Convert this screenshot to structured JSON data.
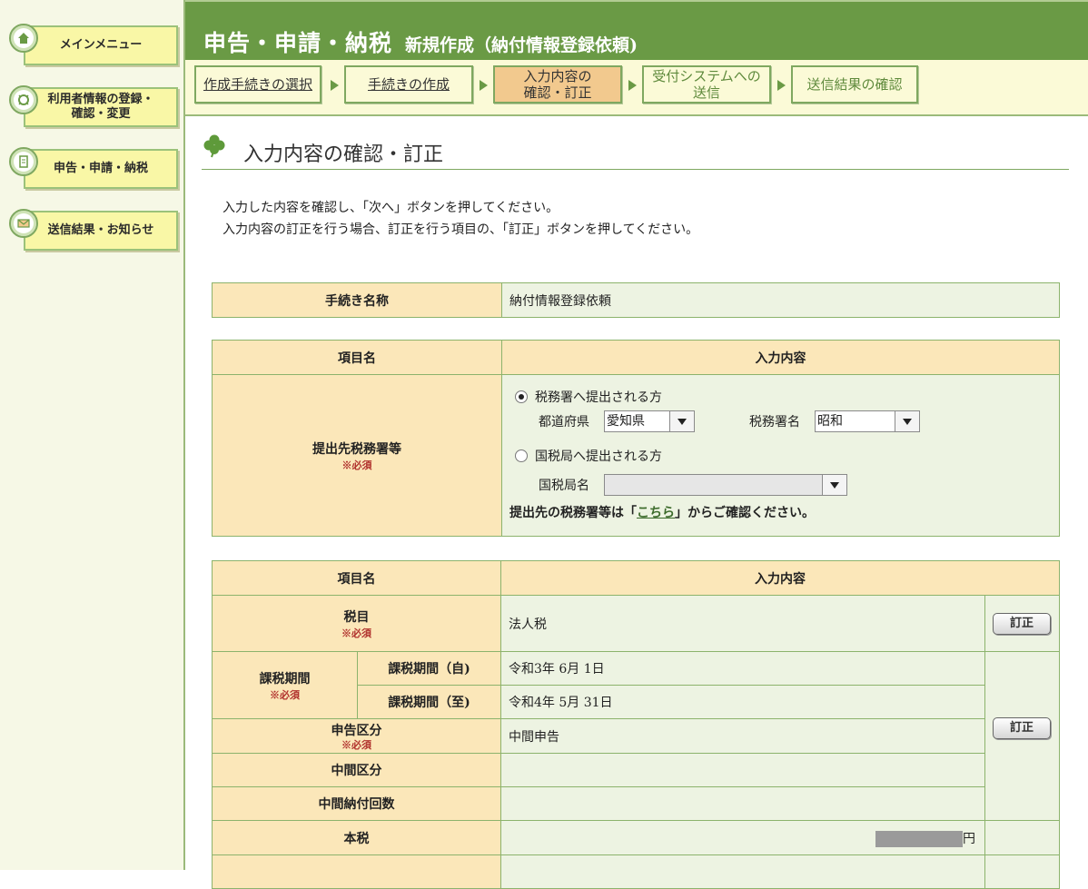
{
  "sidebar": {
    "items": [
      {
        "label": "メインメニュー",
        "icon": "home-icon"
      },
      {
        "label": "利用者情報の登録・確認・変更",
        "line1": "利用者情報の登録・",
        "line2": "確認・変更",
        "icon": "user-info-icon"
      },
      {
        "label": "申告・申請・納税",
        "icon": "document-icon"
      },
      {
        "label": "送信結果・お知らせ",
        "icon": "message-icon"
      }
    ]
  },
  "header": {
    "title": "申告・申請・納税",
    "subtitle": "新規作成（納付情報登録依頼)"
  },
  "steps": [
    {
      "label": "作成手続きの選択"
    },
    {
      "label": "手続きの作成"
    },
    {
      "label": "入力内容の確認・訂正",
      "line1": "入力内容の",
      "line2": "確認・訂正"
    },
    {
      "label": "受付システムへの送信",
      "line1": "受付システムへの",
      "line2": "送信"
    },
    {
      "label": "送信結果の確認"
    }
  ],
  "page": {
    "title": "入力内容の確認・訂正",
    "instructions": [
      "入力した内容を確認し、「次へ」ボタンを押してください。",
      "入力内容の訂正を行う場合、訂正を行う項目の、「訂正」ボタンを押してください。"
    ]
  },
  "procedure_table": {
    "label": "手続き名称",
    "value": "納付情報登録依頼"
  },
  "submission_table": {
    "header_item": "項目名",
    "header_content": "入力内容",
    "row_label": "提出先税務署等",
    "required": "※必須",
    "option1": "税務署へ提出される方",
    "pref_label": "都道府県",
    "pref_value": "愛知県",
    "office_label": "税務署名",
    "office_value": "昭和",
    "option2": "国税局へ提出される方",
    "bureau_label": "国税局名",
    "bureau_value": "",
    "note_prefix": "提出先の税務署等は「",
    "note_link": "こちら",
    "note_suffix": "」からご確認ください。"
  },
  "details_table": {
    "header_item": "項目名",
    "header_content": "入力内容",
    "fix_label": "訂正",
    "required": "※必須",
    "tax_item_label": "税目",
    "tax_item_value": "法人税",
    "period_label": "課税期間",
    "period_from_label": "課税期間（自)",
    "period_from_value": "令和3年 6月 1日",
    "period_to_label": "課税期間（至)",
    "period_to_value": "令和4年 5月 31日",
    "filing_type_label": "申告区分",
    "filing_type_value": "中間申告",
    "interim_type_label": "中間区分",
    "interim_count_label": "中間納付回数",
    "main_tax_label": "本税",
    "yen": "円"
  }
}
